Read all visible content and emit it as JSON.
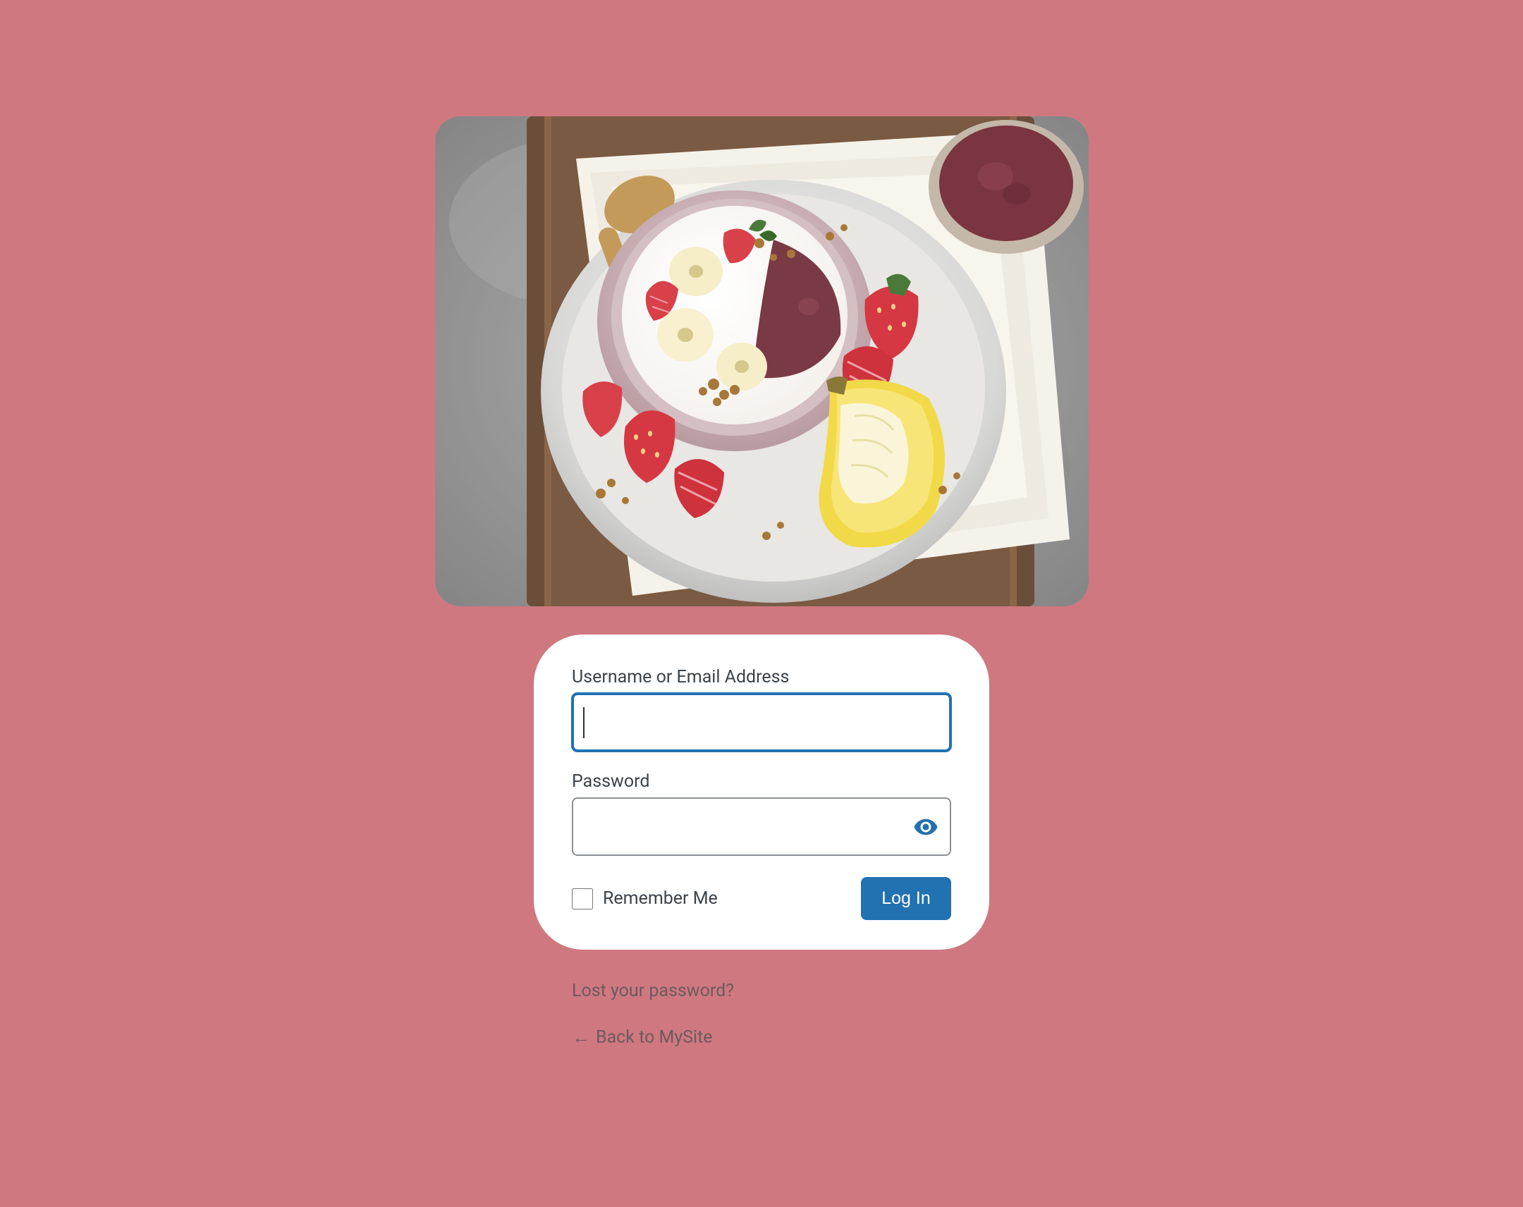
{
  "form": {
    "username_label": "Username or Email Address",
    "username_value": "",
    "password_label": "Password",
    "password_value": "",
    "remember_label": "Remember Me",
    "submit_label": "Log In"
  },
  "links": {
    "lost_password": "Lost your password?",
    "back_to_site": "Back to MySite"
  },
  "colors": {
    "background": "#cf7880",
    "primary": "#2271b1",
    "text": "#3c434a"
  }
}
